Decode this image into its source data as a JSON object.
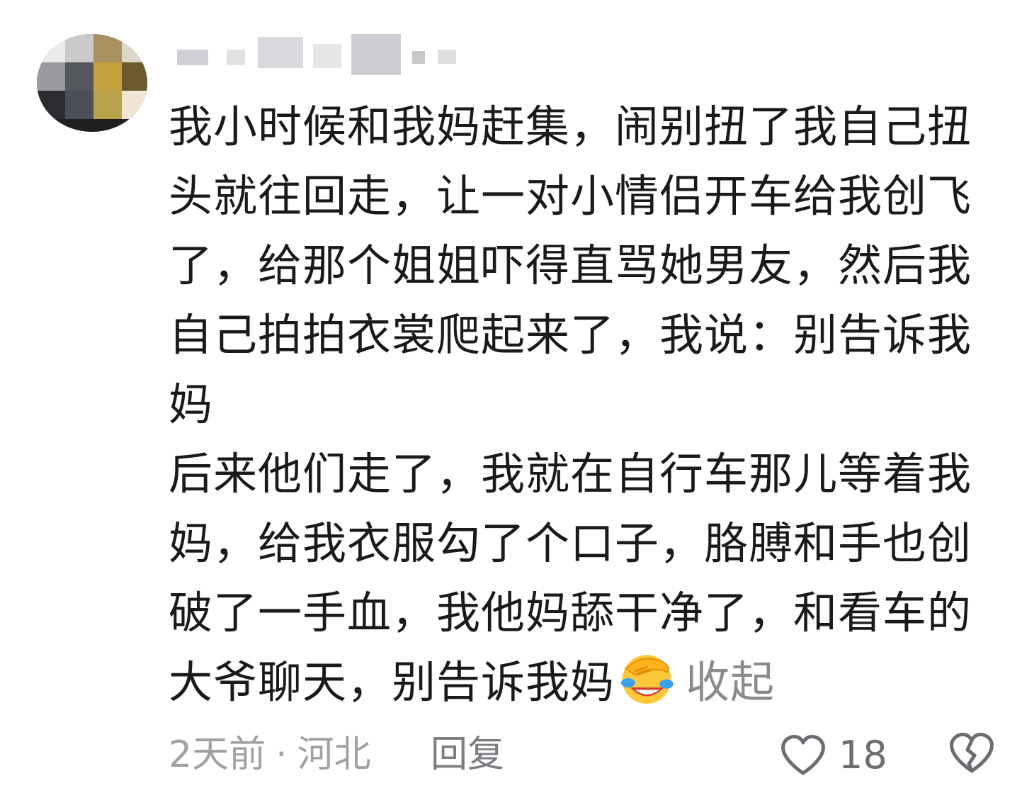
{
  "comment": {
    "avatar_icon": "user-avatar-pixelated",
    "username_censored": true,
    "paragraphs": [
      "我小时候和我妈赶集，闹别扭了我自己扭头就往回走，让一对小情侣开车给我创飞了，给那个姐姐吓得直骂她男友，然后我自己拍拍衣裳爬起来了，我说：别告诉我妈",
      "后来他们走了，我就在自行车那儿等着我妈，给我衣服勾了个口子，胳膊和手也创破了一手血，我他妈舔干净了，和看车的大爷聊天，别告诉我妈"
    ],
    "emoji_icon": "face-palm-laughing-emoji",
    "collapse_label": "收起",
    "time": "2天前",
    "separator": "·",
    "location": "河北",
    "reply_label": "回复",
    "like_icon": "heart-outline-icon",
    "like_count": "18",
    "dislike_icon": "broken-heart-icon"
  },
  "colors": {
    "text": "#1a1a1a",
    "meta": "#a0a0a6",
    "icon": "#6c6c72",
    "background": "#ffffff"
  }
}
